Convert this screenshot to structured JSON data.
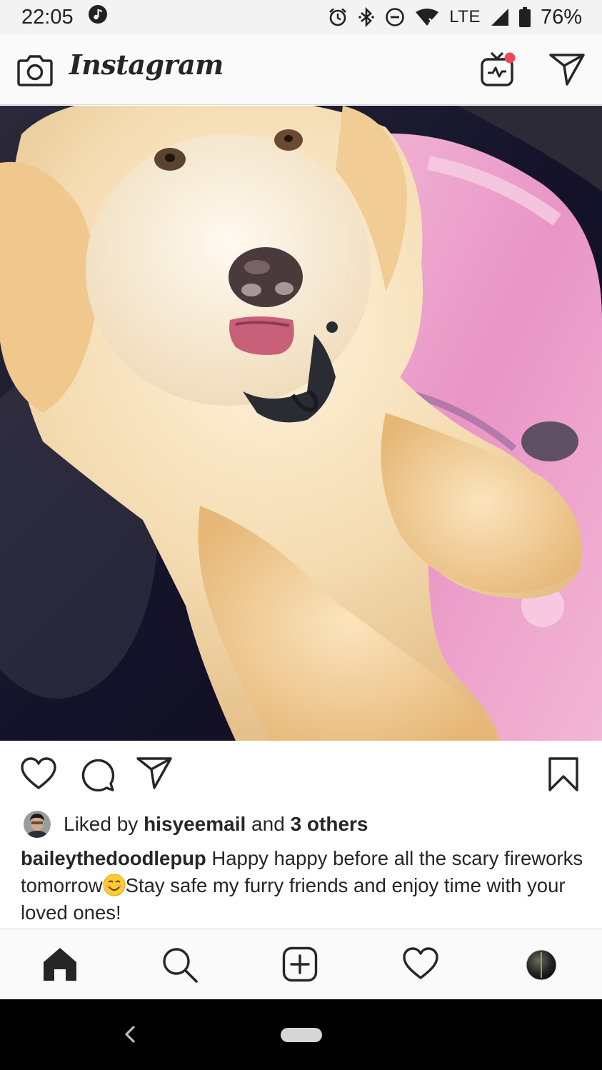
{
  "status_bar": {
    "time": "22:05",
    "network": "LTE",
    "battery": "76%",
    "icons": [
      "music-note-icon",
      "alarm-icon",
      "bluetooth-icon",
      "do-not-disturb-icon",
      "wifi-icon",
      "signal-icon",
      "battery-icon"
    ]
  },
  "header": {
    "app_name": "Instagram",
    "icons": [
      "camera-icon",
      "igtv-icon",
      "direct-message-icon"
    ]
  },
  "post": {
    "photo_subject": "dog-photo",
    "actions": [
      "like-icon",
      "comment-icon",
      "share-icon",
      "bookmark-icon"
    ],
    "likes": {
      "prefix": "Liked by ",
      "user": "hisyeemail",
      "middle": " and ",
      "others": "3 others"
    },
    "caption": {
      "username": "baileythedoodlepup",
      "text_part1": " Happy happy before all the scary fireworks tomorrow",
      "emoji": "smiling-face-emoji",
      "text_part2": "Stay safe my furry friends and enjoy time with your loved ones!"
    }
  },
  "bottom_nav": {
    "items": [
      "home-icon",
      "search-icon",
      "new-post-icon",
      "activity-icon",
      "profile-avatar"
    ],
    "active": "home-icon"
  },
  "colors": {
    "text": "#262626",
    "notification_dot": "#ed4956",
    "border": "#dbdbdb"
  }
}
